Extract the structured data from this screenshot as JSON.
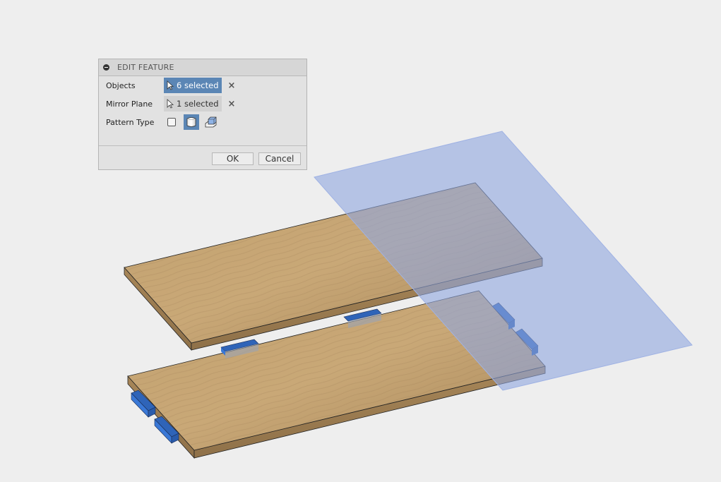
{
  "dialog": {
    "title": "EDIT FEATURE",
    "rows": [
      {
        "label": "Objects",
        "selection": "6 selected",
        "active": true
      },
      {
        "label": "Mirror Plane",
        "selection": "1 selected",
        "active": false
      }
    ],
    "pattern_type": {
      "label": "Pattern Type",
      "options": [
        "faces",
        "bodies",
        "features"
      ],
      "selected": "bodies"
    },
    "ok_label": "OK",
    "cancel_label": "Cancel",
    "clear_icon": "×"
  },
  "scene": {
    "description": "Two wooden boards with blue tabs and a translucent mirror plane",
    "colors": {
      "background": "#eeeeee",
      "wood": "#b89868",
      "tab": "#3572cc",
      "plane": "#a7b7e2",
      "accent": "#5b86b5"
    }
  }
}
